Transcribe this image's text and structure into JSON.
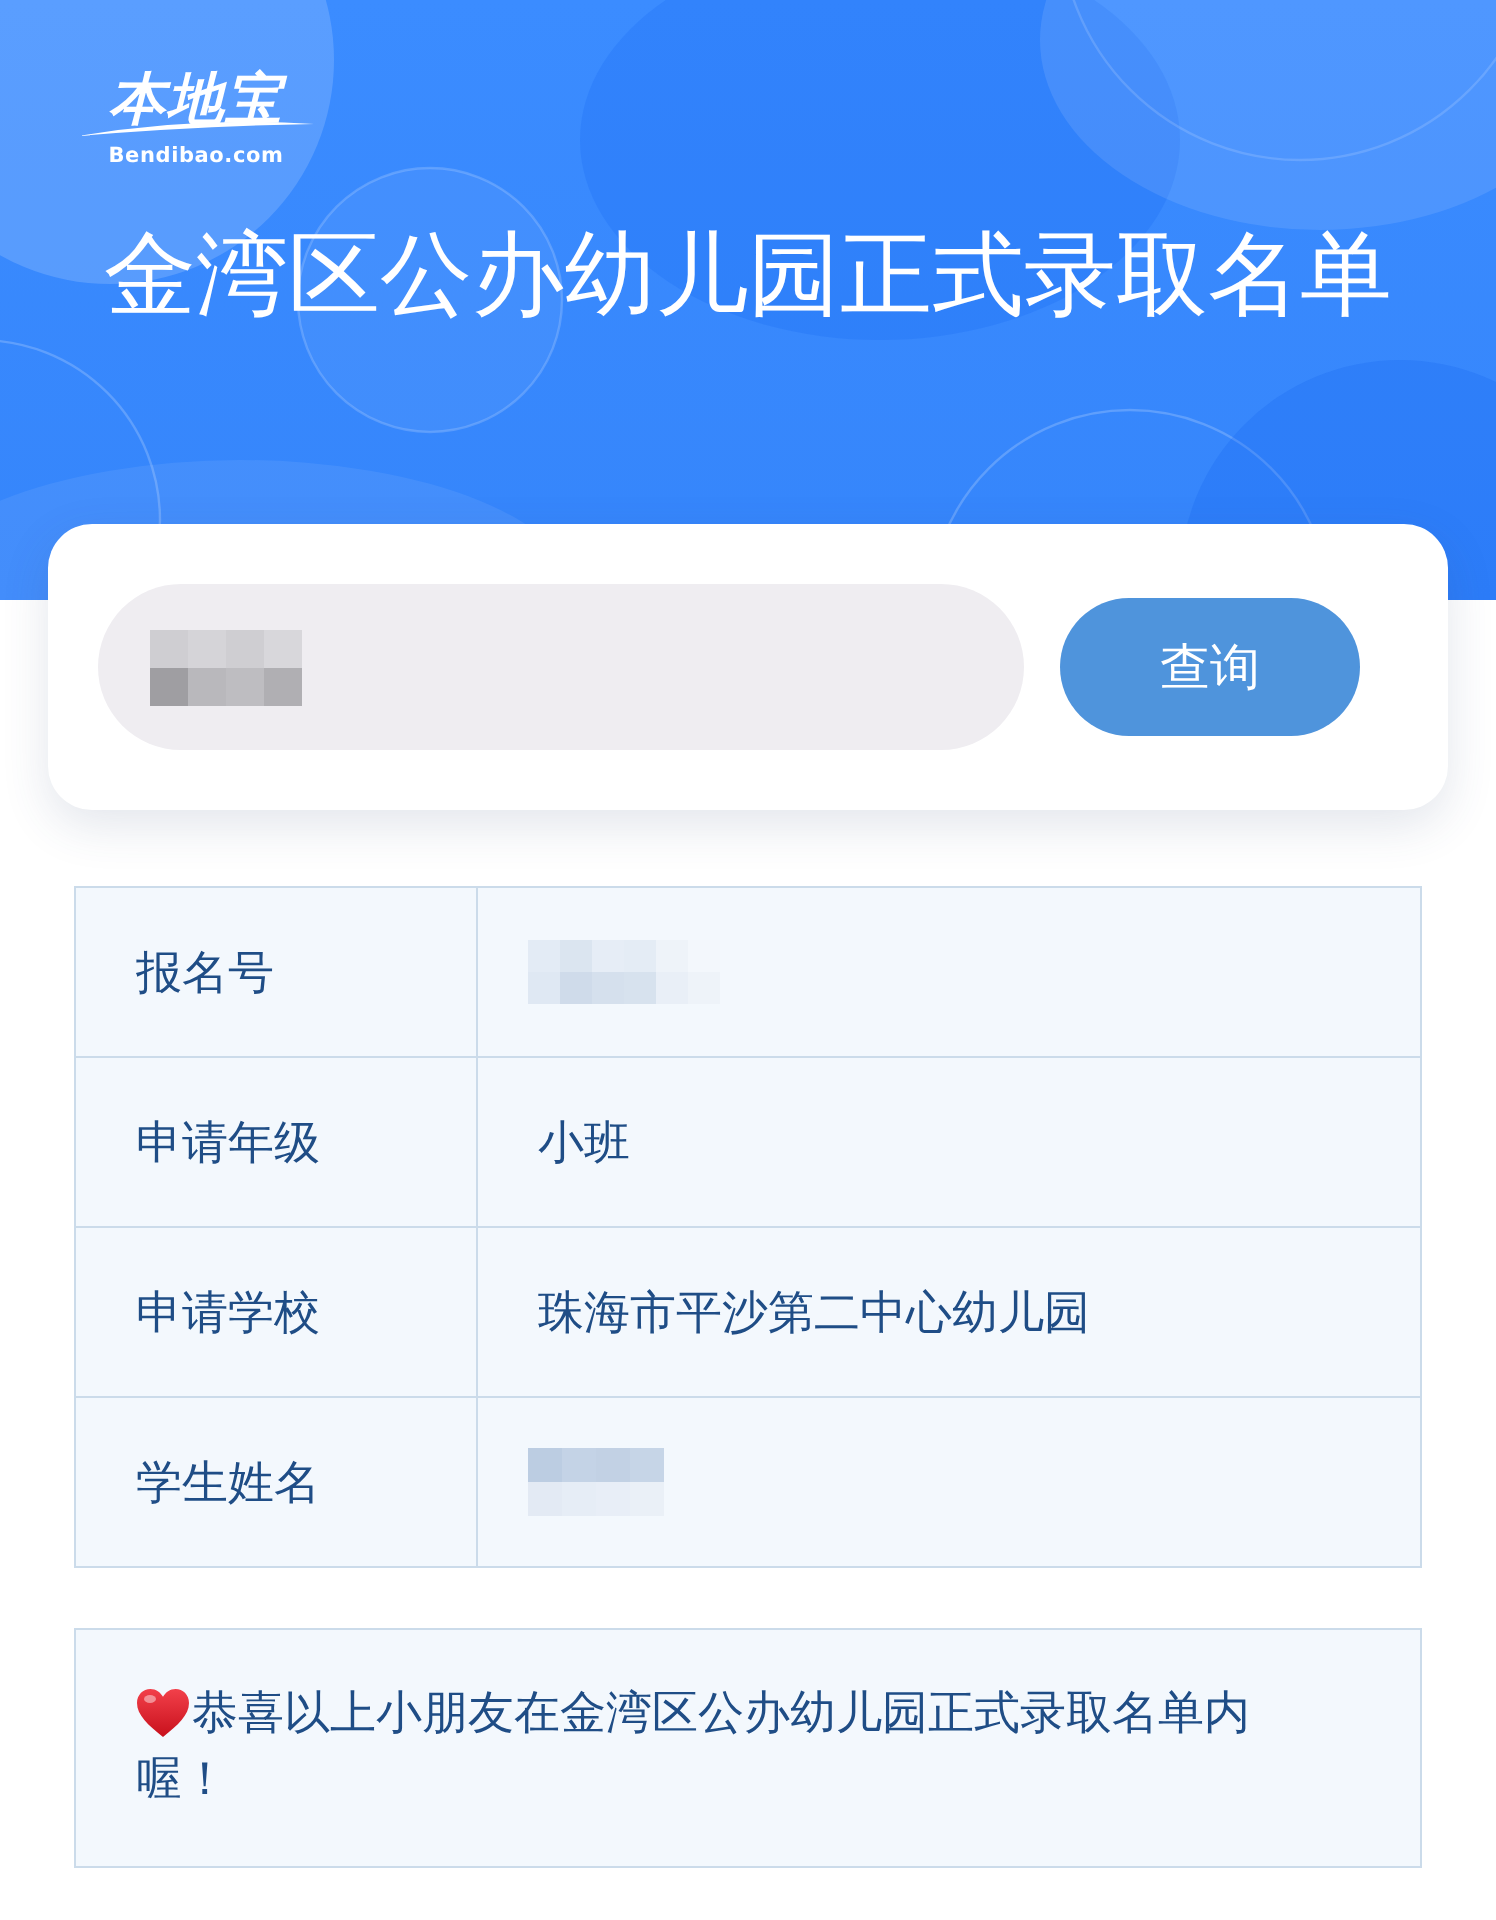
{
  "header": {
    "logo": {
      "wordmark": "本地宝",
      "domain": "Bendibao.com"
    },
    "title": "金湾区公办幼儿园正式录取名单"
  },
  "search": {
    "redacted": true,
    "button": "查询"
  },
  "result_table": {
    "rows": [
      {
        "label": "报名号",
        "kind": "redacted"
      },
      {
        "label": "申请年级",
        "kind": "text",
        "value": "小班"
      },
      {
        "label": "申请学校",
        "kind": "text",
        "value": "珠海市平沙第二中心幼儿园"
      },
      {
        "label": "学生姓名",
        "kind": "redacted"
      }
    ]
  },
  "notice": {
    "text": "恭喜以上小朋友在金湾区公办幼儿园正式录取名单内喔！"
  }
}
